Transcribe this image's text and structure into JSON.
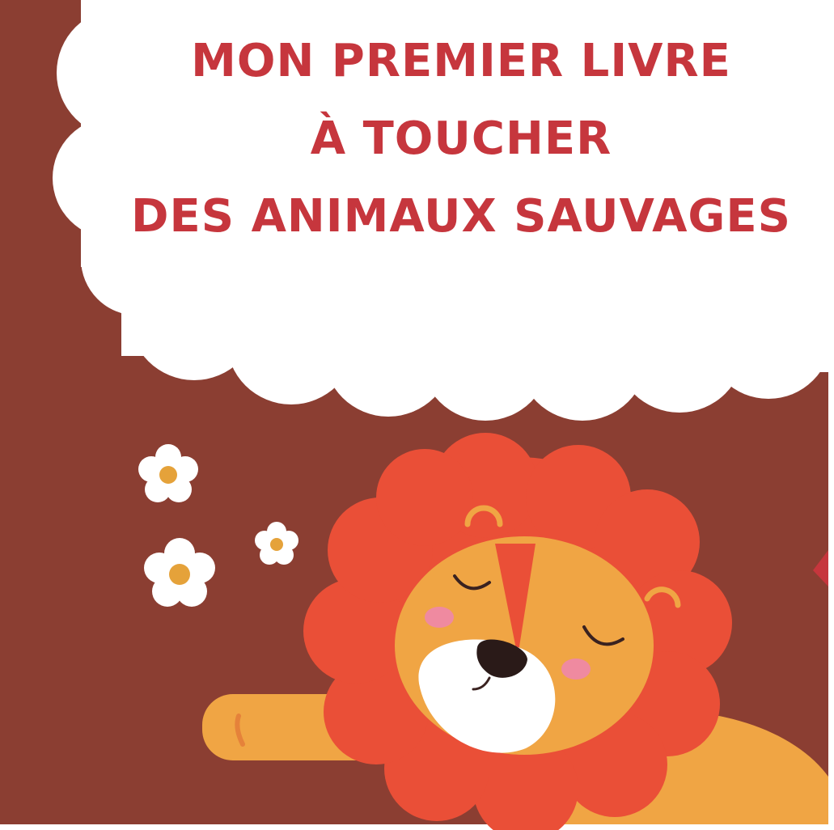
{
  "cover": {
    "title_lines": [
      "MON PREMIER LIVRE",
      "À TOUCHER",
      "DES ANIMAUX SAUVAGES"
    ],
    "illustration": {
      "subject": "sleeping-lion",
      "decorations": [
        "flower-icon",
        "flower-icon",
        "flower-icon"
      ]
    }
  },
  "colors": {
    "background": "#8b3e32",
    "cloud": "#ffffff",
    "title_text": "#c6363d",
    "mane": "#ea4f37",
    "lion_face": "#f0a544",
    "muzzle": "#ffffff",
    "nose": "#2a1a18",
    "cheek": "#ef8aa0",
    "flower_center": "#e5a23a"
  }
}
